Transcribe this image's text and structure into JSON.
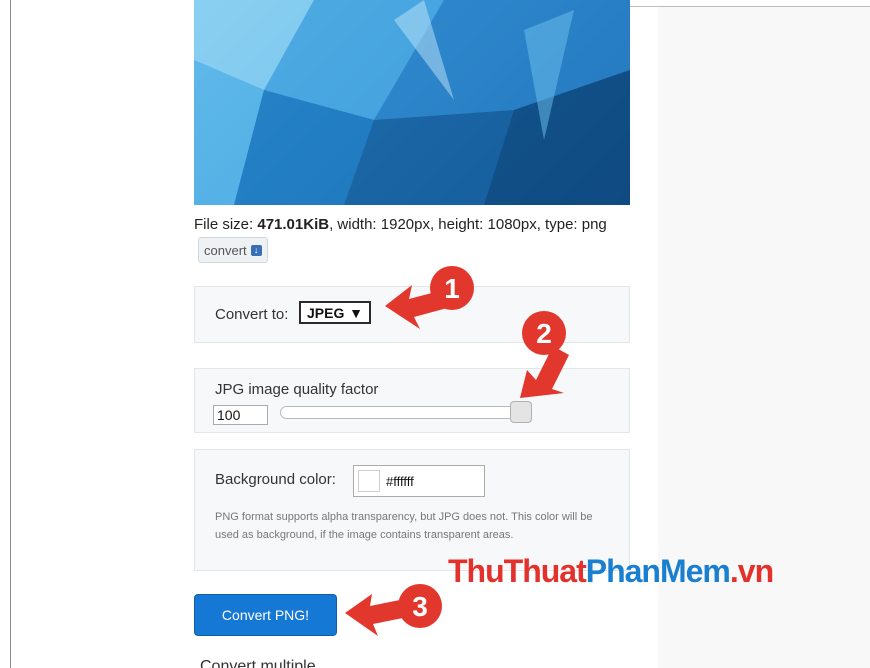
{
  "file_info": {
    "prefix": "File size: ",
    "size": "471.01KiB",
    "details": ", width: 1920px, height: 1080px, type: png",
    "convert_label": "convert"
  },
  "convert_to": {
    "label": "Convert to:",
    "selected": "JPEG"
  },
  "quality": {
    "label": "JPG image quality factor",
    "value": "100",
    "level_percent": 100
  },
  "background": {
    "label": "Background color:",
    "value": "#ffffff",
    "hint": "PNG format supports alpha transparency, but JPG does not. This color will be used as background, if the image contains transparent areas."
  },
  "primary_button": {
    "label": "Convert PNG!"
  },
  "bottom_text": "Convert multiple",
  "watermark": {
    "part1": "ThuThuat",
    "part2": "PhanMem",
    "part3": ".vn"
  },
  "callouts": [
    "1",
    "2",
    "3"
  ],
  "colors": {
    "accent": "#1578d4",
    "callout": "#e2372d",
    "watermark_red": "#e2322b",
    "watermark_blue": "#1b7fd0"
  }
}
